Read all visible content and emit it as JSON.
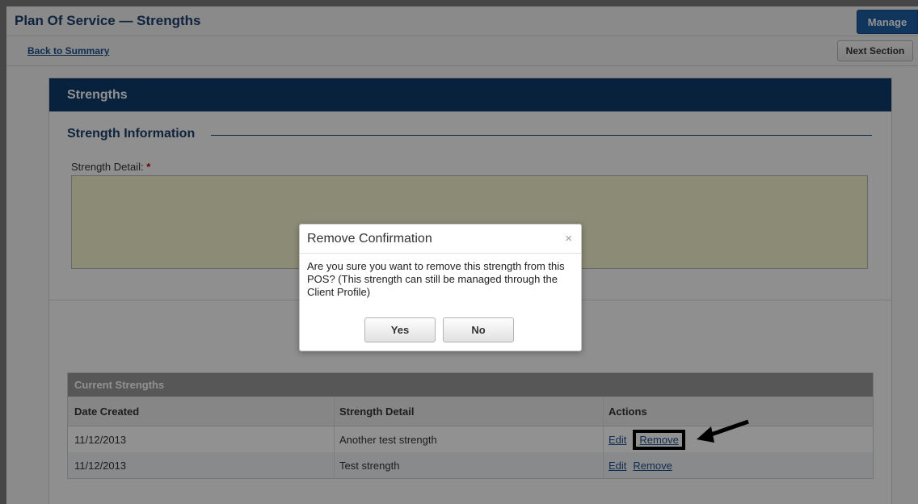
{
  "header": {
    "title": "Plan Of Service — Strengths",
    "manage_label": "Manage"
  },
  "nav": {
    "back_label": "Back to Summary",
    "next_label": "Next Section"
  },
  "panel": {
    "title": "Strengths",
    "section_title": "Strength Information",
    "field_label": "Strength Detail:",
    "required_mark": "*",
    "textarea_value": ""
  },
  "grid": {
    "caption": "Current Strengths",
    "columns": [
      "Date Created",
      "Strength Detail",
      "Actions"
    ],
    "rows": [
      {
        "date": "11/12/2013",
        "detail": "Another test strength",
        "edit": "Edit",
        "remove": "Remove"
      },
      {
        "date": "11/12/2013",
        "detail": "Test strength",
        "edit": "Edit",
        "remove": "Remove"
      }
    ]
  },
  "modal": {
    "title": "Remove Confirmation",
    "close_glyph": "×",
    "message": "Are you sure you want to remove this strength from this POS? (This strength can still be managed through the Client Profile)",
    "yes_label": "Yes",
    "no_label": "No"
  },
  "colors": {
    "header_blue": "#0f3d6e",
    "accent_blue": "#1f5fa6",
    "textarea_bg": "#f6f4cf"
  }
}
